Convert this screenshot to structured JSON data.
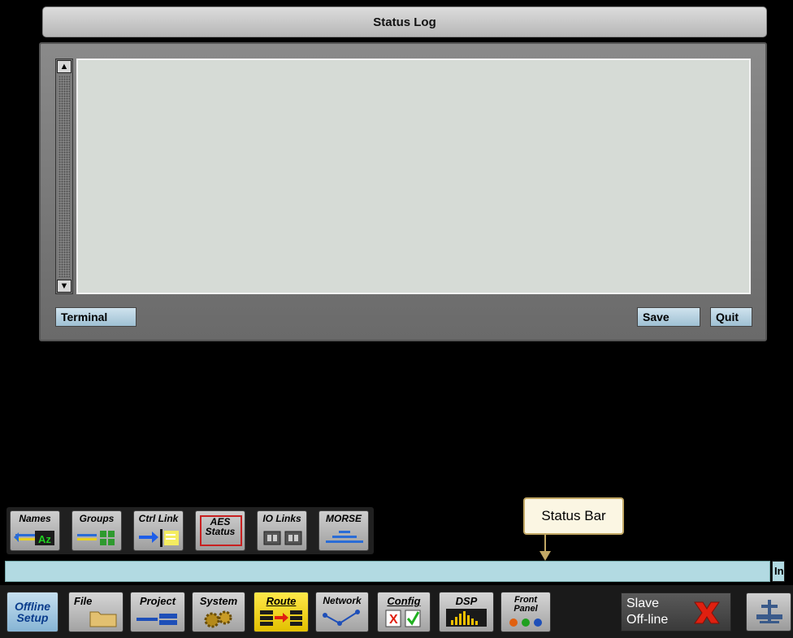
{
  "window": {
    "title": "Status Log",
    "terminal_label": "Terminal",
    "save_label": "Save",
    "quit_label": "Quit",
    "scroll_up": "▲",
    "scroll_down": "▼",
    "log_text": ""
  },
  "sub_toolbar": [
    {
      "label": "Names",
      "icon": "names-az-icon"
    },
    {
      "label": "Groups",
      "icon": "groups-grid-icon"
    },
    {
      "label": "Ctrl Link",
      "icon": "ctrl-link-icon"
    },
    {
      "label": "AES Status",
      "icon": "aes-status-icon"
    },
    {
      "label": "IO Links",
      "icon": "io-links-icon"
    },
    {
      "label": "MORSE",
      "icon": "morse-icon"
    }
  ],
  "status_bar": {
    "text": "",
    "right_label": "In"
  },
  "callout": {
    "label": "Status Bar"
  },
  "main_toolbar": [
    {
      "label": "Offline Setup",
      "icon": "none"
    },
    {
      "label": "File",
      "icon": "folder-icon"
    },
    {
      "label": "Project",
      "icon": "project-icon"
    },
    {
      "label": "System",
      "icon": "gears-icon"
    },
    {
      "label": "Route",
      "icon": "route-arrow-icon"
    },
    {
      "label": "Network",
      "icon": "network-icon"
    },
    {
      "label": "Config",
      "icon": "config-check-icon"
    },
    {
      "label": "DSP",
      "icon": "dsp-meter-icon"
    },
    {
      "label": "Front Panel",
      "icon": "front-panel-icon"
    }
  ],
  "slave_status": {
    "line1": "Slave",
    "line2": "Off-line",
    "icon": "red-x-icon"
  },
  "console_icon": "console-icon",
  "colors": {
    "status_bar": "#b2dae2",
    "route_active": "#ffe94a",
    "offline_active": "#86b4d4",
    "callout_border": "#c2a865",
    "slave_x": "#e02010"
  }
}
